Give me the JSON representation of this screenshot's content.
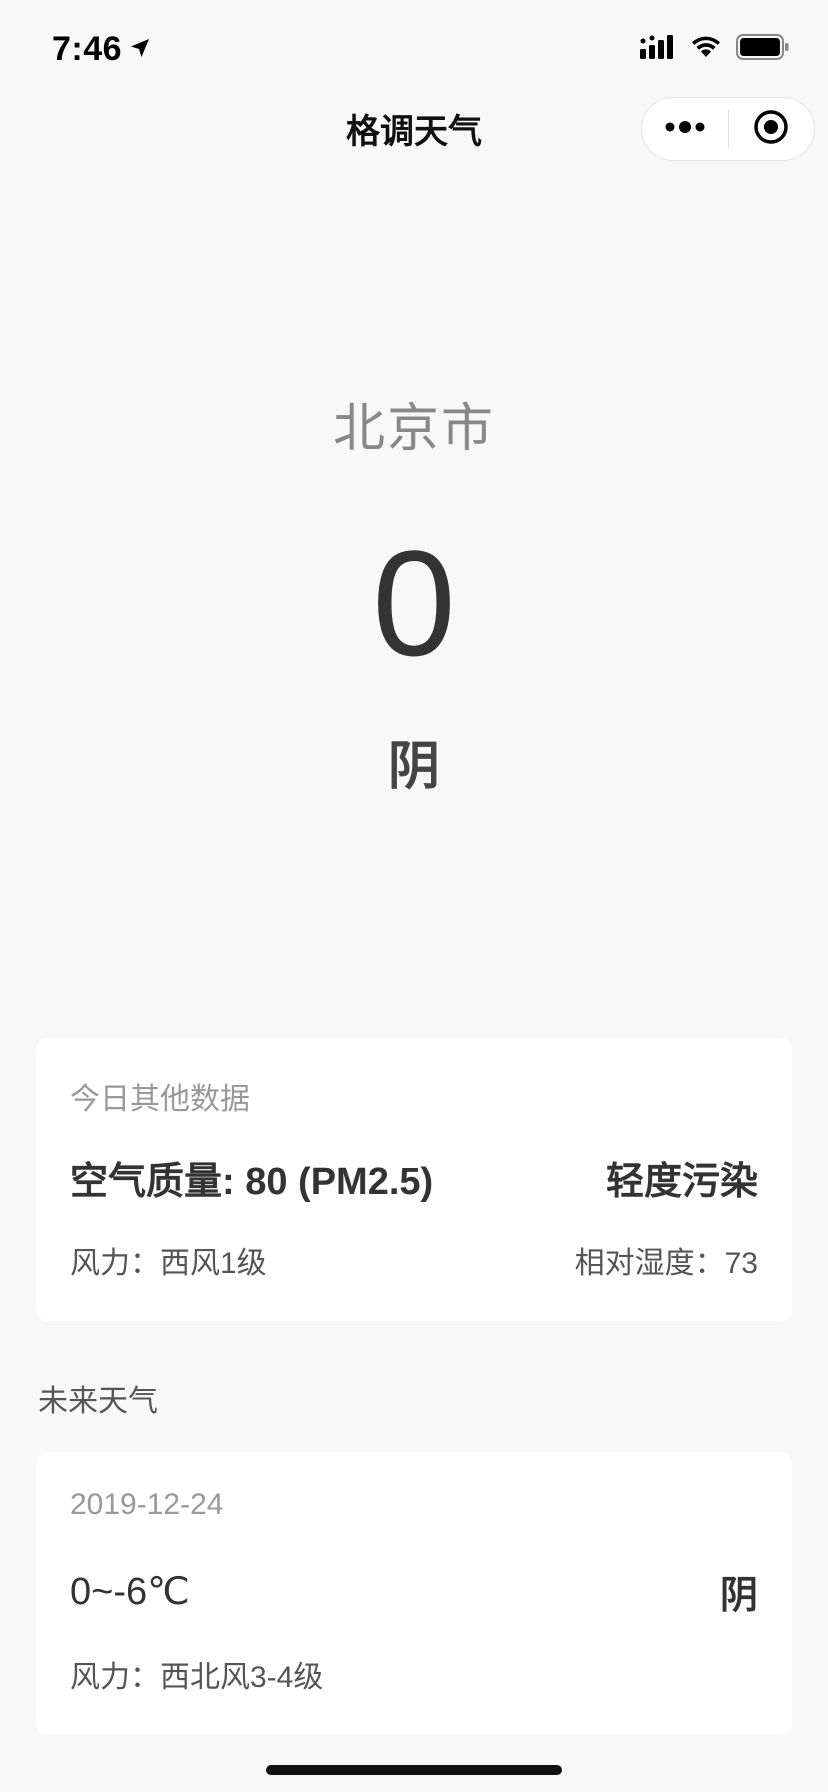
{
  "status_bar": {
    "time": "7:46"
  },
  "nav": {
    "title": "格调天气"
  },
  "hero": {
    "city": "北京市",
    "temperature": "0",
    "condition": "阴"
  },
  "today_card": {
    "label": "今日其他数据",
    "air_quality": "空气质量: 80 (PM2.5)",
    "air_level": "轻度污染",
    "wind": "风力：西风1级",
    "humidity": "相对湿度：73"
  },
  "future_section": {
    "title": "未来天气"
  },
  "forecast": [
    {
      "date": "2019-12-24",
      "temp_range": "0~-6℃",
      "condition": "阴",
      "wind": "风力：西北风3-4级"
    }
  ]
}
